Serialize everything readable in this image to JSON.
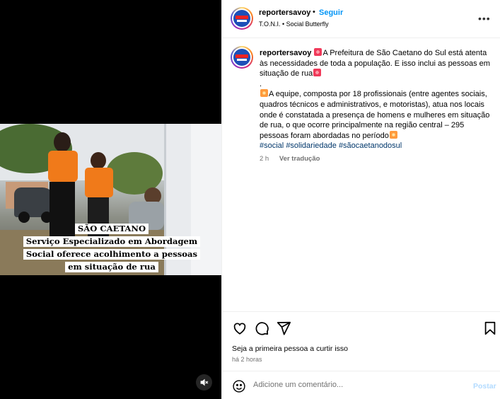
{
  "post": {
    "media": {
      "caption_title": "SÃO CAETANO",
      "caption_lines": [
        "Serviço Especializado em Abordagem",
        "Social oferece acolhimento a pessoas",
        "em situação de rua"
      ],
      "mute_icon": "speaker-muted-icon"
    },
    "header": {
      "username": "reportersavoy",
      "separator": "•",
      "follow_label": "Seguir",
      "subtitle": "T.O.N.I. • Social Butterfly",
      "more_icon": "more-options-icon"
    },
    "caption": {
      "username": "reportersavoy",
      "text1": "A Prefeitura de São Caetano do Sul está atenta às necessidades de toda a população. E isso inclui as pessoas em situação de rua",
      "dot": ".",
      "text2": "A equipe, composta por 18 profissionais (entre agentes sociais, quadros técnicos e administrativos, e motoristas), atua nos locais onde é constatada a presença de homens e mulheres em situação de rua, o que ocorre principalmente na região central – 295 pessoas foram abordadas no período",
      "hashtags": [
        "#social",
        "#solidariedade",
        "#sãocaetanodosul"
      ],
      "age": "2 h",
      "translate_label": "Ver tradução"
    },
    "actions": {
      "like_icon": "heart-icon",
      "comment_icon": "comment-icon",
      "share_icon": "share-icon",
      "save_icon": "bookmark-icon",
      "likes_text": "Seja a primeira pessoa a curtir isso",
      "timestamp": "há 2 horas"
    },
    "add_comment": {
      "emoji_icon": "emoji-icon",
      "placeholder": "Adicione um comentário...",
      "post_label": "Postar"
    }
  }
}
